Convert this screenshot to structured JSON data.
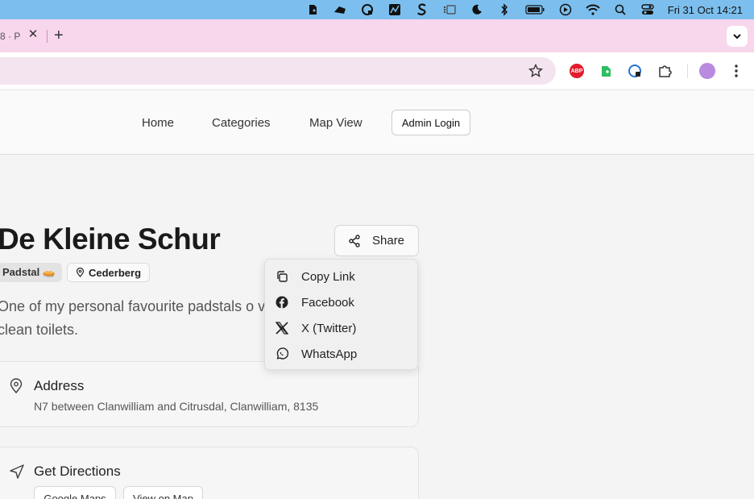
{
  "menubar": {
    "icons": [
      "evernote-icon",
      "cloud-icon",
      "vpn-icon",
      "activity-monitor-icon",
      "s-app-icon",
      "stage-manager-icon",
      "focus-moon-icon",
      "bluetooth-icon",
      "battery-icon",
      "play-icon",
      "wifi-icon",
      "spotlight-search-icon",
      "control-center-icon"
    ],
    "clock": "Fri 31 Oct  14:21"
  },
  "browser": {
    "tab_title_fragment": "8 · P",
    "toolbar_icons": [
      "star-icon",
      "adblock-icon",
      "evernote-extension-icon",
      "password-extension-icon",
      "extensions-icon",
      "profile-avatar-icon",
      "menu-dots-icon"
    ],
    "adblock_label": "ABP"
  },
  "nav": {
    "links": [
      "Home",
      "Categories",
      "Map View"
    ],
    "admin_login": "Admin Login"
  },
  "listing": {
    "title": "De Kleine Schur",
    "category_badge": "Padstal 🥧",
    "location_badge": "Cederberg",
    "description": "One of my personal favourite padstals o very clean toilets.",
    "share_label": "Share"
  },
  "share_menu": {
    "items": [
      {
        "label": "Copy Link",
        "icon": "copy-icon"
      },
      {
        "label": "Facebook",
        "icon": "facebook-icon"
      },
      {
        "label": "X (Twitter)",
        "icon": "x-twitter-icon"
      },
      {
        "label": "WhatsApp",
        "icon": "whatsapp-icon"
      }
    ]
  },
  "address_card": {
    "title": "Address",
    "text": "N7 between Clanwilliam and Citrusdal, Clanwilliam, 8135"
  },
  "directions_card": {
    "title": "Get Directions",
    "buttons": [
      "Google Maps",
      "View on Map"
    ]
  }
}
